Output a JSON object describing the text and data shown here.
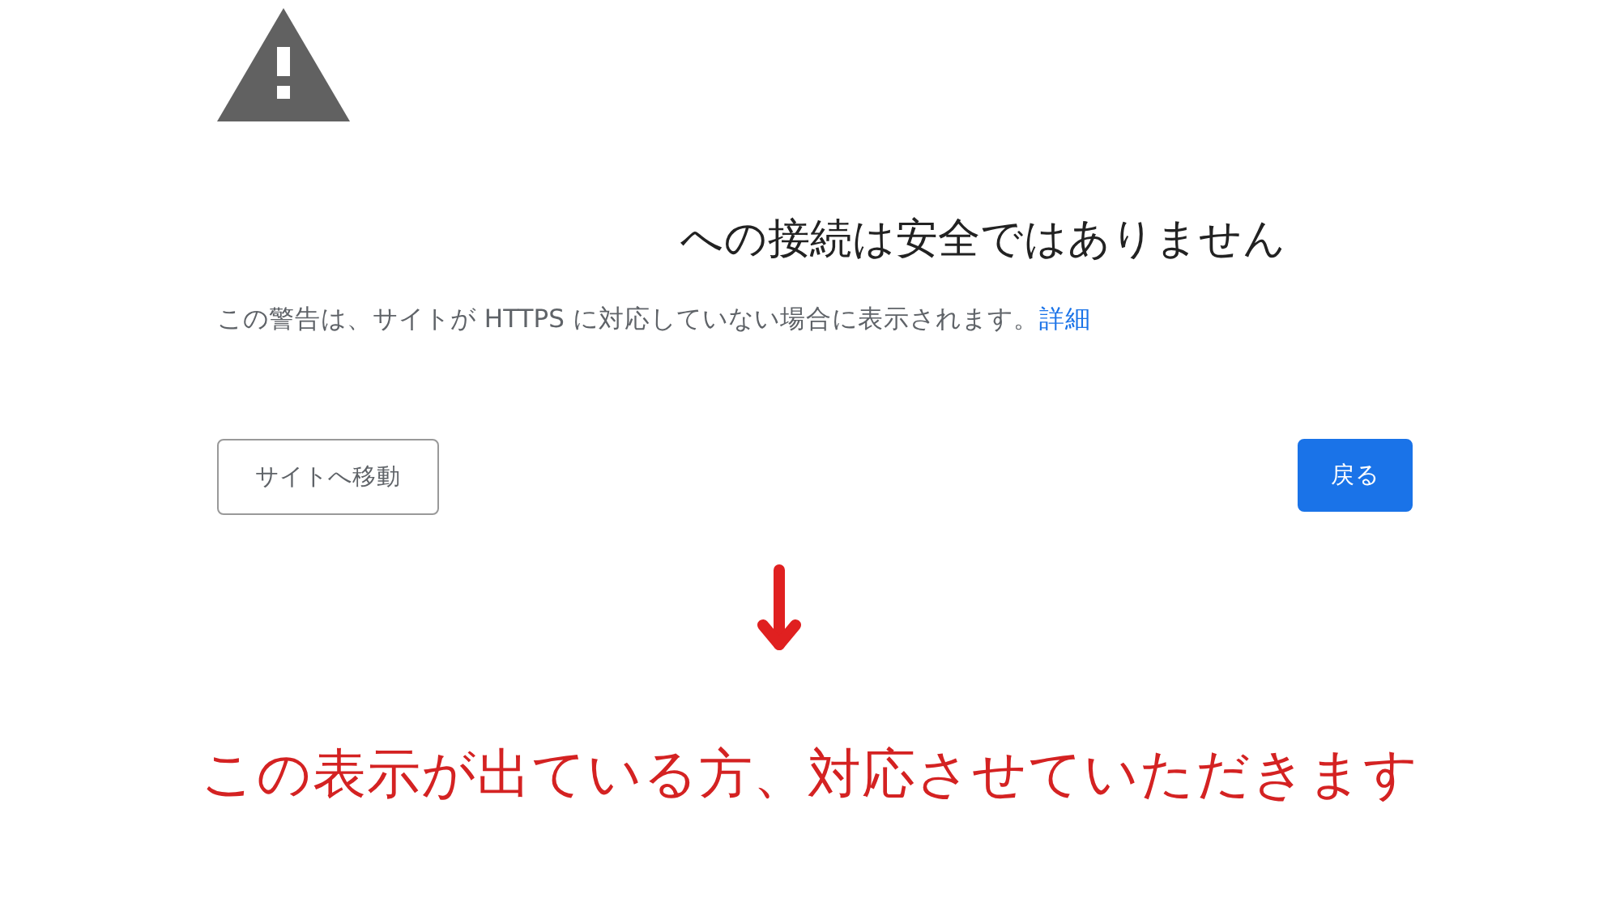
{
  "warning": {
    "heading": "への接続は安全ではありません",
    "description": "この警告は、サイトが HTTPS に対応していない場合に表示されます。",
    "details_link": "詳細",
    "buttons": [
      {
        "label": "サイトへ移動",
        "kind": "secondary"
      },
      {
        "label": "戻る",
        "kind": "primary"
      }
    ]
  },
  "annotation": {
    "text": "この表示が出ている方、対応させていただきます"
  }
}
